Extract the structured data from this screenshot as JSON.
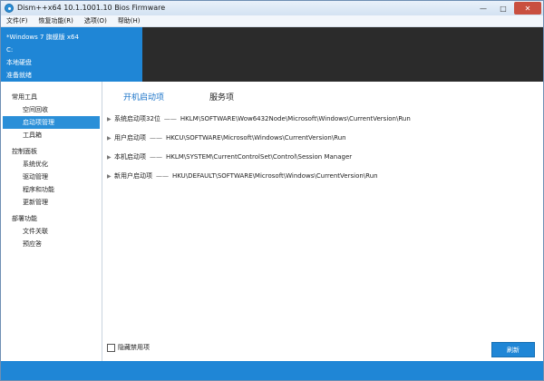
{
  "window": {
    "title": "Dism++x64 10.1.1001.10 Bios Firmware",
    "min_glyph": "—",
    "max_glyph": "□",
    "close_glyph": "✕"
  },
  "menu": [
    {
      "label": "文件(F)"
    },
    {
      "label": "恢复功能(R)"
    },
    {
      "label": "选项(O)"
    },
    {
      "label": "帮助(H)"
    }
  ],
  "info": {
    "os": "*Windows 7 旗舰版 x64",
    "drive": "C:",
    "disk": "本地硬盘",
    "status": "准备就绪"
  },
  "sidebar": {
    "groups": [
      {
        "title": "常用工具",
        "items": [
          "空间回收",
          "启动项管理",
          "工具箱"
        ]
      },
      {
        "title": "控制面板",
        "items": [
          "系统优化",
          "驱动管理",
          "程序和功能",
          "更新管理"
        ]
      },
      {
        "title": "部署功能",
        "items": [
          "文件关联",
          "预应答"
        ]
      }
    ],
    "active_item": "启动项管理"
  },
  "tabs": [
    {
      "label": "开机启动项",
      "active": true
    },
    {
      "label": "服务项",
      "active": false
    }
  ],
  "entries": [
    {
      "label": "系统启动项32位",
      "dash": "——",
      "path": "HKLM\\SOFTWARE\\Wow6432Node\\Microsoft\\Windows\\CurrentVersion\\Run"
    },
    {
      "label": "用户启动项",
      "dash": "——",
      "path": "HKCU\\SOFTWARE\\Microsoft\\Windows\\CurrentVersion\\Run"
    },
    {
      "label": "本机启动项",
      "dash": "——",
      "path": "HKLM\\SYSTEM\\CurrentControlSet\\Control\\Session Manager"
    },
    {
      "label": "新用户启动项",
      "dash": "——",
      "path": "HKU\\DEFAULT\\SOFTWARE\\Microsoft\\Windows\\CurrentVersion\\Run"
    }
  ],
  "hide_disabled_label": "隐藏禁用项",
  "refresh_label": "刷新",
  "colors": {
    "accent": "#1f86d6",
    "dark_panel": "#2b2b2b",
    "active_tab": "#1a73c8"
  }
}
